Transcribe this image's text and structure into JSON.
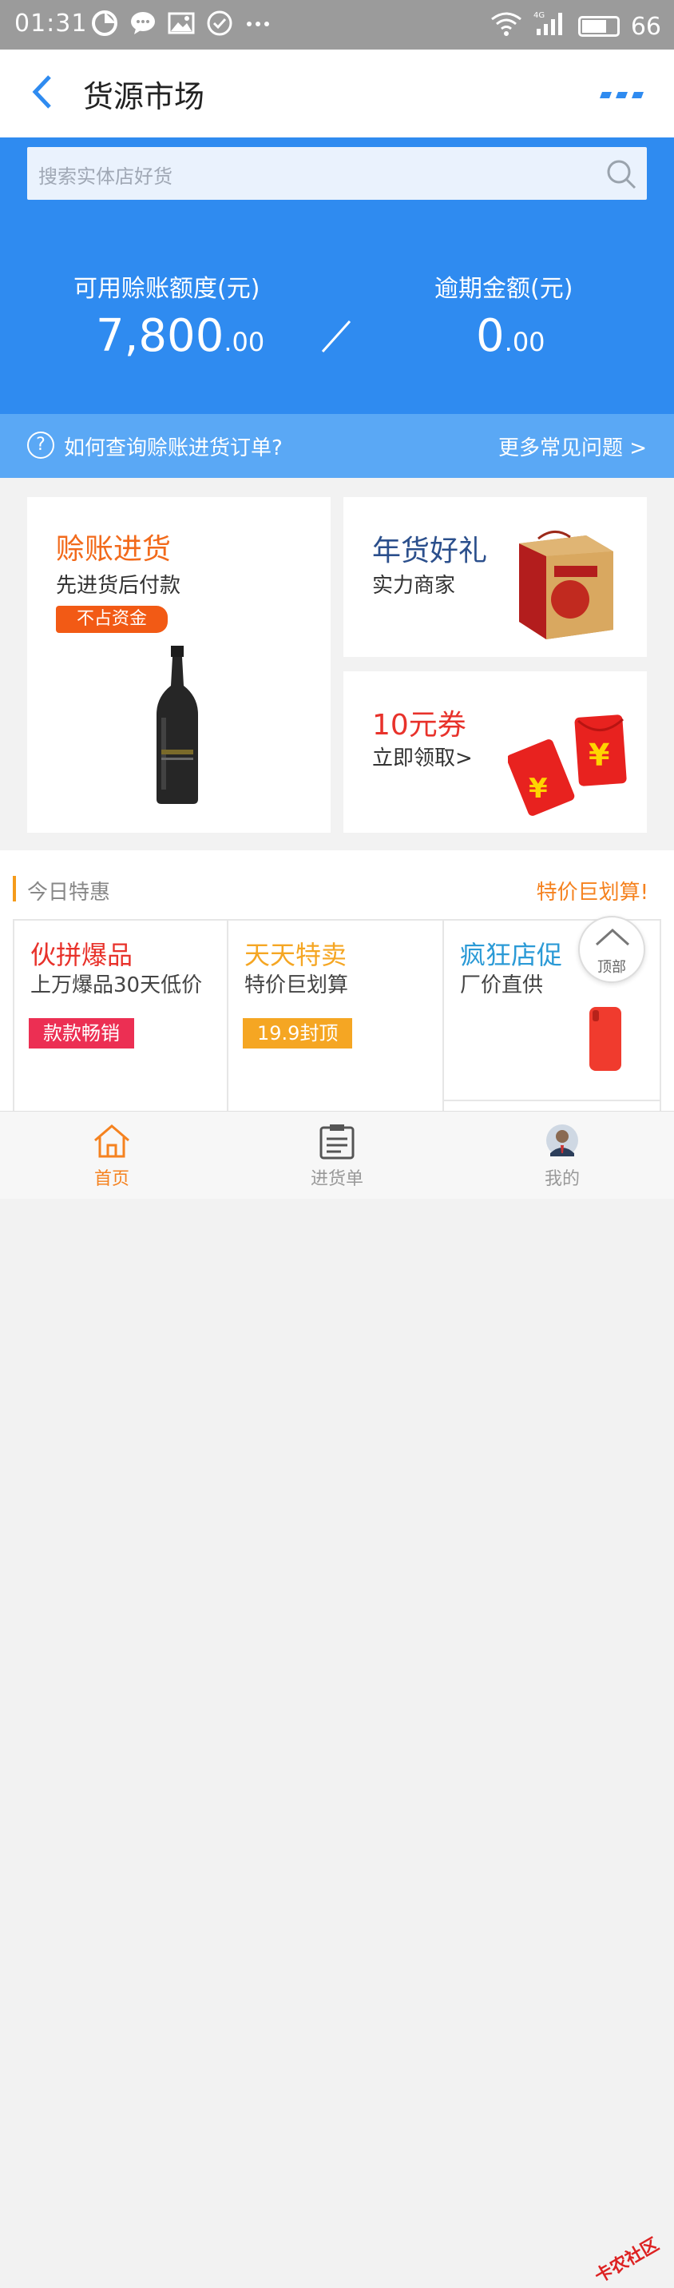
{
  "status": {
    "time": "01:31",
    "battery": "66",
    "network": "4G"
  },
  "nav": {
    "title": "货源市场"
  },
  "search": {
    "placeholder": "搜索实体店好货"
  },
  "credit": {
    "available_label": "可用赊账额度(元)",
    "available_int": "7,800",
    "available_dec": ".00",
    "overdue_label": "逾期金额(元)",
    "overdue_int": "0",
    "overdue_dec": ".00"
  },
  "faq": {
    "question": "如何查询赊账进货订单?",
    "more": "更多常见问题 >"
  },
  "cards": {
    "credit_purchase": {
      "title": "赊账进货",
      "subtitle": "先进货后付款",
      "tag": "不占资金"
    },
    "newyear": {
      "title": "年货好礼",
      "subtitle": "实力商家"
    },
    "coupon": {
      "title": "10元券",
      "subtitle": "立即领取>"
    }
  },
  "today": {
    "title": "今日特惠",
    "slogan": "特价巨划算!",
    "items": [
      {
        "title": "伙拼爆品",
        "subtitle": "上万爆品30天低价",
        "tag": "款款畅销"
      },
      {
        "title": "天天特卖",
        "subtitle": "特价巨划算",
        "tag": "19.9封顶"
      },
      {
        "title": "疯狂店促",
        "subtitle": "厂价直供"
      }
    ],
    "top_button": "顶部"
  },
  "tabs": [
    {
      "label": "首页"
    },
    {
      "label": "进货单"
    },
    {
      "label": "我的"
    }
  ],
  "watermark": "卡农社区",
  "colors": {
    "header_blue": "#2f8bf0",
    "faq_blue": "#5aa8f5",
    "accent_orange": "#f5821f",
    "red": "#e8322b",
    "navy": "#2b4f8c",
    "yellow_orange": "#f5a623"
  }
}
